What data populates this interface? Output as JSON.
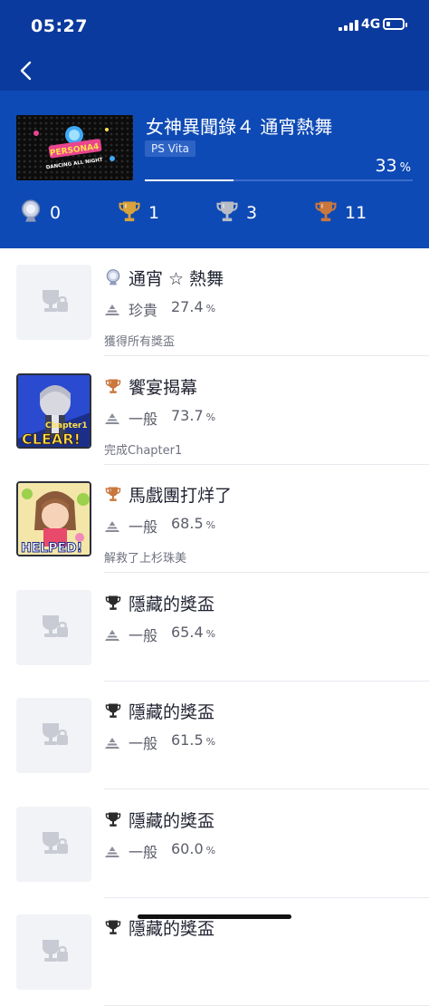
{
  "status_bar": {
    "time": "05:27",
    "network": "4G",
    "battery_level": 0.2
  },
  "game": {
    "title": "女神異聞錄４ 通宵熱舞",
    "platform": "PS Vita",
    "progress_value": "33",
    "progress_unit": "%",
    "progress_fraction": 0.33,
    "counts": {
      "platinum": "0",
      "gold": "1",
      "silver": "3",
      "bronze": "11"
    }
  },
  "colors": {
    "header_blue": "#0e4ab5",
    "nav_blue": "#0b3a9e",
    "platinum": "#9aa6c4",
    "gold": "#d9a23b",
    "silver": "#b8bcc6",
    "bronze": "#c9773d",
    "hidden": "#2b2b2b"
  },
  "trophies": [
    {
      "tier": "platinum",
      "name": "通宵 ☆ 熱舞",
      "rarity_label": "珍貴",
      "rarity_value": "27.4",
      "rarity_unit": "%",
      "description": "獲得所有獎盃",
      "thumb": "placeholder-trophy-icon"
    },
    {
      "tier": "bronze",
      "name": "饗宴揭幕",
      "rarity_label": "一般",
      "rarity_value": "73.7",
      "rarity_unit": "%",
      "description": "完成Chapter1",
      "thumb": "chapter1-clear-art"
    },
    {
      "tier": "bronze",
      "name": "馬戲團打烊了",
      "rarity_label": "一般",
      "rarity_value": "68.5",
      "rarity_unit": "%",
      "description": "解救了上杉珠美",
      "thumb": "helped-art"
    },
    {
      "tier": "hidden",
      "name": "隱藏的獎盃",
      "rarity_label": "一般",
      "rarity_value": "65.4",
      "rarity_unit": "%",
      "description": "",
      "thumb": "placeholder-trophy-icon"
    },
    {
      "tier": "hidden",
      "name": "隱藏的獎盃",
      "rarity_label": "一般",
      "rarity_value": "61.5",
      "rarity_unit": "%",
      "description": "",
      "thumb": "placeholder-trophy-icon"
    },
    {
      "tier": "hidden",
      "name": "隱藏的獎盃",
      "rarity_label": "一般",
      "rarity_value": "60.0",
      "rarity_unit": "%",
      "description": "",
      "thumb": "placeholder-trophy-icon"
    },
    {
      "tier": "hidden",
      "name": "隱藏的獎盃",
      "rarity_label": "",
      "rarity_value": "",
      "rarity_unit": "",
      "description": "",
      "thumb": "placeholder-trophy-icon"
    }
  ],
  "cover_logo": {
    "line1": "PERSONA4",
    "line2": "DANCING ALL NIGHT"
  },
  "thumb_text": {
    "chapter": "Chapter1",
    "clear": "CLEAR!",
    "helped": "HELPED!"
  }
}
